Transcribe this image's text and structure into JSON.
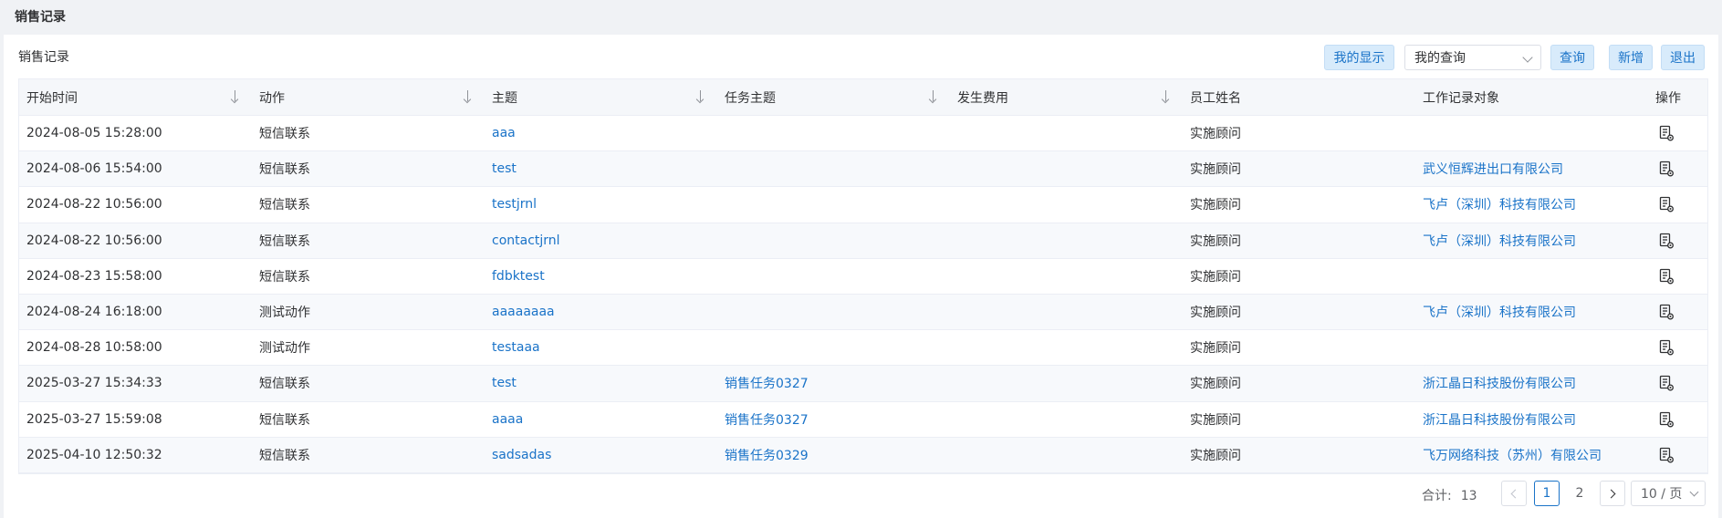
{
  "page": {
    "title": "销售记录"
  },
  "panel": {
    "title": "销售记录"
  },
  "toolbar": {
    "my_display": "我的显示",
    "my_query": "我的查询",
    "query": "查询",
    "add": "新增",
    "exit": "退出"
  },
  "table": {
    "columns": [
      "开始时间",
      "动作",
      "主题",
      "任务主题",
      "发生费用",
      "员工姓名",
      "工作记录对象",
      "操作"
    ],
    "rows": [
      [
        "2024-08-05 15:28:00",
        "短信联系",
        "aaa",
        "",
        "",
        "实施顾问",
        ""
      ],
      [
        "2024-08-06 15:54:00",
        "短信联系",
        "test",
        "",
        "",
        "实施顾问",
        "武义恒辉进出口有限公司"
      ],
      [
        "2024-08-22 10:56:00",
        "短信联系",
        "testjrnl",
        "",
        "",
        "实施顾问",
        "飞卢（深圳）科技有限公司"
      ],
      [
        "2024-08-22 10:56:00",
        "短信联系",
        "contactjrnl",
        "",
        "",
        "实施顾问",
        "飞卢（深圳）科技有限公司"
      ],
      [
        "2024-08-23 15:58:00",
        "短信联系",
        "fdbktest",
        "",
        "",
        "实施顾问",
        ""
      ],
      [
        "2024-08-24 16:18:00",
        "测试动作",
        "aaaaaaaa",
        "",
        "",
        "实施顾问",
        "飞卢（深圳）科技有限公司"
      ],
      [
        "2024-08-28 10:58:00",
        "测试动作",
        "testaaa",
        "",
        "",
        "实施顾问",
        ""
      ],
      [
        "2025-03-27 15:34:33",
        "短信联系",
        "test",
        "销售任务0327",
        "",
        "实施顾问",
        "浙江晶日科技股份有限公司"
      ],
      [
        "2025-03-27 15:59:08",
        "短信联系",
        "aaaa",
        "销售任务0327",
        "",
        "实施顾问",
        "浙江晶日科技股份有限公司"
      ],
      [
        "2025-04-10 12:50:32",
        "短信联系",
        "sadsadas",
        "销售任务0329",
        "",
        "实施顾问",
        "飞万网络科技（苏州）有限公司"
      ]
    ],
    "action_icon": "document-settings-icon"
  },
  "pagination": {
    "total_label": "合计:",
    "total": "13",
    "page1": "1",
    "page2": "2",
    "page_size": "10 / 页"
  },
  "colors": {
    "accent": "#1a73c8",
    "button_bg": "#d8ebfb"
  }
}
